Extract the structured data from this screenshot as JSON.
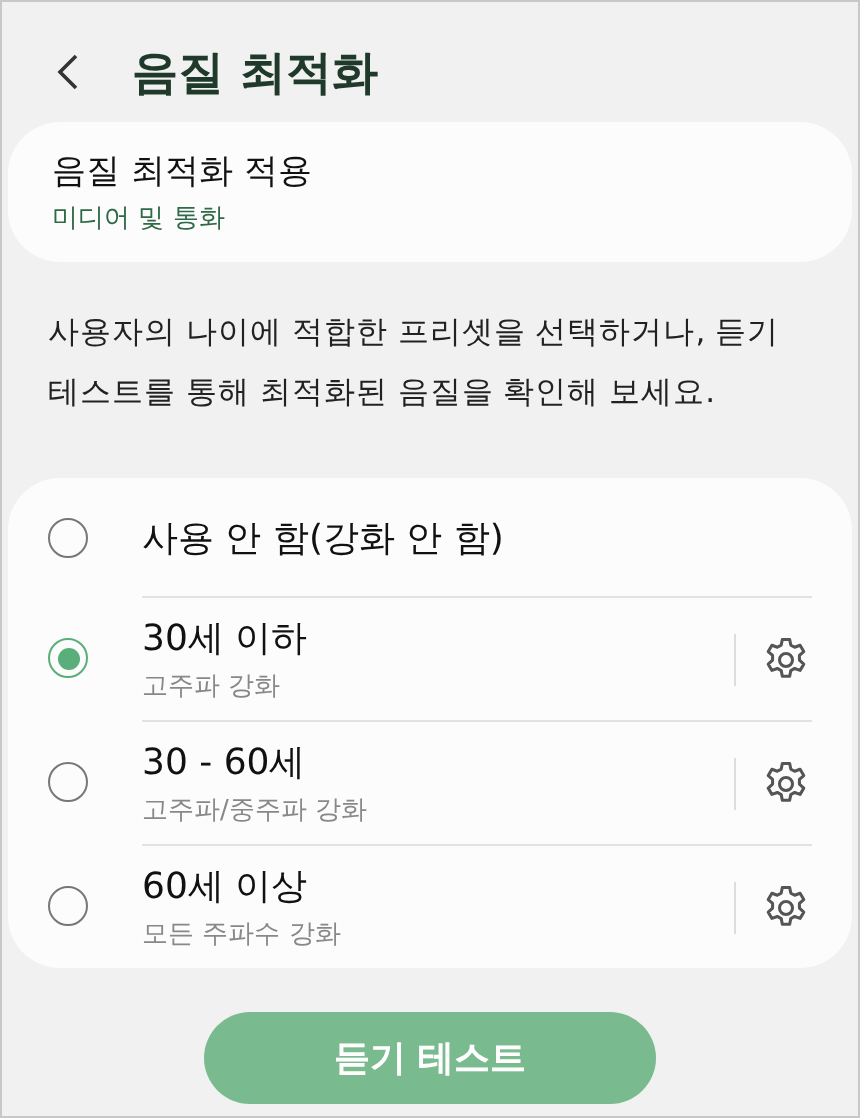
{
  "header": {
    "title": "음질 최적화"
  },
  "apply_card": {
    "title": "음질 최적화 적용",
    "subtitle": "미디어 및 통화"
  },
  "description": "사용자의 나이에 적합한 프리셋을 선택하거나, 듣기 테스트를 통해 최적화된 음질을 확인해 보세요.",
  "options": [
    {
      "kind": "plain",
      "label": "사용 안 함(강화 안 함)",
      "selected": false
    },
    {
      "kind": "adjustable",
      "label": "30세 이하",
      "detail": "고주파 강화",
      "selected": true
    },
    {
      "kind": "adjustable",
      "label": "30 - 60세",
      "detail": "고주파/중주파 강화",
      "selected": false
    },
    {
      "kind": "adjustable",
      "label": "60세 이상",
      "detail": "모든 주파수 강화",
      "selected": false
    }
  ],
  "button": {
    "label": "듣기 테스트"
  }
}
